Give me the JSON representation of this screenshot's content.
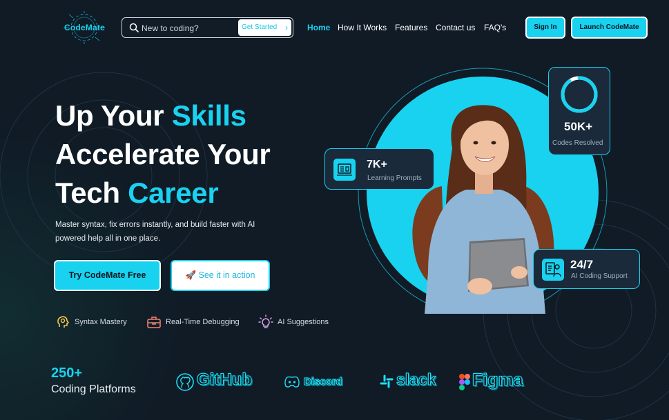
{
  "brand": {
    "name": "CodeMate"
  },
  "search": {
    "placeholder": "New to coding?",
    "cta_label": "Get Started"
  },
  "nav": {
    "links": [
      {
        "label": "Home",
        "active": true
      },
      {
        "label": "How It Works",
        "active": false
      },
      {
        "label": "Features",
        "active": false
      },
      {
        "label": "Contact us",
        "active": false
      },
      {
        "label": "FAQ's",
        "active": false
      }
    ],
    "sign_in_label": "Sign In",
    "launch_label": "Launch CodeMate"
  },
  "hero": {
    "line1_plain": "Up Your ",
    "line1_accent": "Skills",
    "line2": "Accelerate Your",
    "line3_plain": "Tech ",
    "line3_accent": "Career",
    "subtext": "Master syntax, fix errors instantly, and build faster with AI powered help all in one place.",
    "primary_cta": "Try CodeMate Free",
    "secondary_cta": "🚀 See it in action",
    "features": [
      {
        "label": "Syntax Mastery",
        "icon": "brain-bulb-icon"
      },
      {
        "label": "Real-Time Debugging",
        "icon": "toolbox-icon"
      },
      {
        "label": "AI Suggestions",
        "icon": "lightbulb-icon"
      }
    ]
  },
  "stats": {
    "codes": {
      "value": "50K+",
      "label": "Codes Resolved",
      "progress": 0.9
    },
    "prompts": {
      "value": "7K+",
      "label": "Learning Prompts",
      "icon": "screen-board-icon"
    },
    "support": {
      "value": "24/7",
      "label": "AI Coding Support",
      "icon": "support-agent-icon"
    }
  },
  "platforms": {
    "count": "250+",
    "label": "Coding Platforms",
    "logos": [
      "GitHub",
      "Discord",
      "slack",
      "Figma"
    ]
  },
  "colors": {
    "accent": "#19d2f0",
    "background": "#101b26",
    "card": "#1a2a3b"
  }
}
